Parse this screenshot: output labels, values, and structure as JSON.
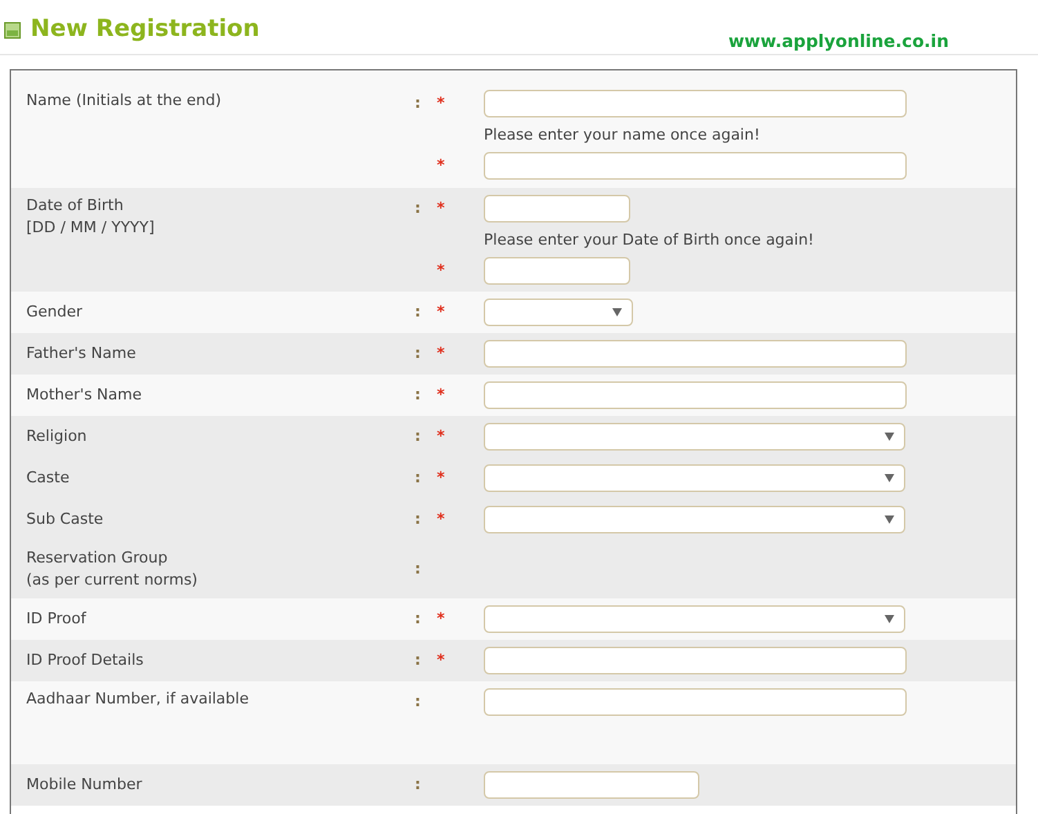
{
  "header": {
    "title": "New Registration",
    "site": "www.applyonline.co.in"
  },
  "fields": [
    {
      "label": "Name (Initials at the end)",
      "colon": ":",
      "mark": "*",
      "kind": "text",
      "shaded": false,
      "confirm": {
        "hint": "Please enter your name once again!",
        "mark": "*"
      }
    },
    {
      "label": "Date of Birth\n[DD / MM / YYYY]",
      "colon": ":",
      "mark": "*",
      "kind": "short-text",
      "shaded": true,
      "confirm": {
        "hint": "Please enter your Date of Birth once again!",
        "mark": "*"
      }
    },
    {
      "label": "Gender",
      "colon": ":",
      "mark": "*",
      "kind": "short-select",
      "shaded": false
    },
    {
      "label": "Father's Name",
      "colon": ":",
      "mark": "*",
      "kind": "text",
      "shaded": true
    },
    {
      "label": "Mother's Name",
      "colon": ":",
      "mark": "*",
      "kind": "text",
      "shaded": false
    },
    {
      "label": "Religion",
      "colon": ":",
      "mark": "*",
      "kind": "select",
      "shaded": true
    },
    {
      "label": "Caste",
      "colon": ":",
      "mark": "*",
      "kind": "select",
      "shaded": true
    },
    {
      "label": "Sub Caste",
      "colon": ":",
      "mark": "*",
      "kind": "select",
      "shaded": true
    },
    {
      "label": "Reservation Group\n(as per current norms)",
      "colon": ":",
      "kind": "none",
      "shaded": true
    },
    {
      "label": "ID Proof",
      "colon": ":",
      "mark": "*",
      "kind": "select",
      "shaded": false
    },
    {
      "label": "ID Proof Details",
      "colon": ":",
      "mark": "*",
      "kind": "text",
      "shaded": true
    },
    {
      "label": "Aadhaar Number, if available",
      "colon": ":",
      "kind": "text",
      "shaded": false
    },
    {
      "label": "Mobile Number",
      "colon": ":",
      "kind": "medium-text",
      "shaded": true
    }
  ]
}
